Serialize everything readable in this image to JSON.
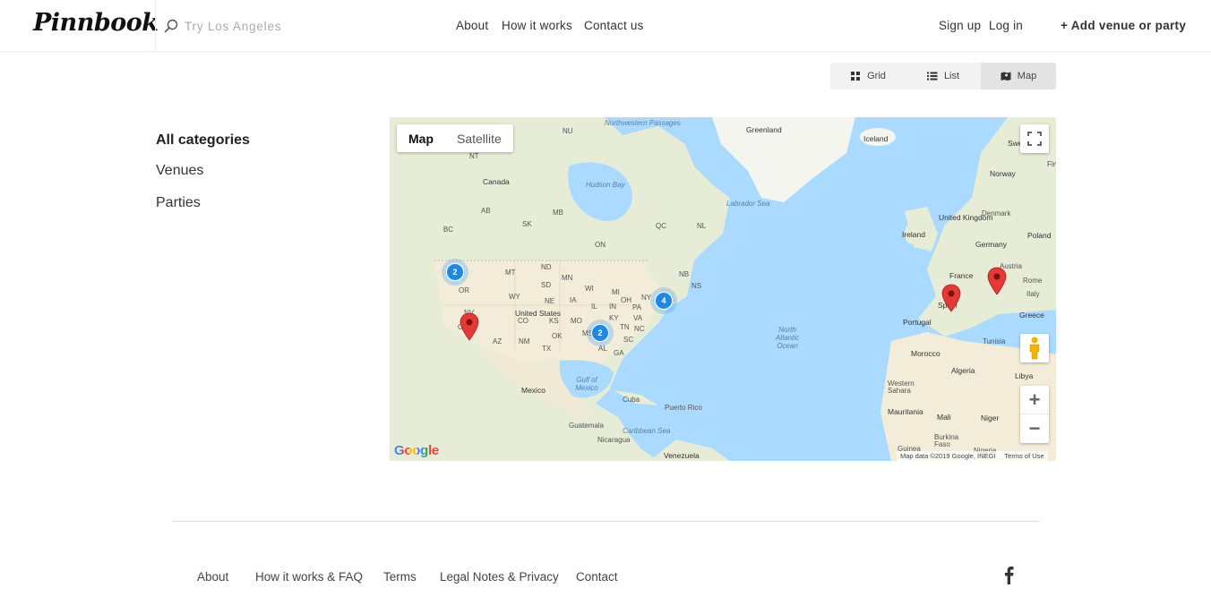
{
  "header": {
    "logo": "Pinnbook",
    "search_placeholder": "Try Los Angeles",
    "nav": [
      "About",
      "How it works",
      "Contact us"
    ],
    "signup": "Sign up",
    "login": "Log in",
    "add_venue": "+ Add venue or party"
  },
  "view_toggle": {
    "grid": "Grid",
    "list": "List",
    "map": "Map",
    "active": "map"
  },
  "categories": {
    "items": [
      "All categories",
      "Venues",
      "Parties"
    ],
    "active": "All categories"
  },
  "map": {
    "type_map": "Map",
    "type_satellite": "Satellite",
    "zoom_in": "+",
    "zoom_out": "−",
    "google": "Google",
    "attribution": "Map data ©2019 Google, INEGI",
    "terms": "Terms of Use",
    "clusters": [
      {
        "count": "2"
      },
      {
        "count": "4"
      },
      {
        "count": "2"
      }
    ],
    "labels": {
      "canada": "Canada",
      "greenland": "Greenland",
      "iceland": "Iceland",
      "norway": "Norway",
      "hudson_bay": "Hudson Bay",
      "labrador_sea": "Labrador Sea",
      "nw_passages": "Northwestern Passages",
      "ireland": "Ireland",
      "united_kingdom": "United Kingdom",
      "denmark": "Denmark",
      "germany": "Germany",
      "poland": "Poland",
      "france": "France",
      "austria": "Austria",
      "spain": "Spain",
      "portugal": "Portugal",
      "italy": "Italy",
      "rome": "Rome",
      "greece": "Greece",
      "tunisia": "Tunisia",
      "morocco": "Morocco",
      "algeria": "Algeria",
      "libya": "Libya",
      "western_sahara": "Western Sahara",
      "mauritania": "Mauritania",
      "mali": "Mali",
      "niger": "Niger",
      "burkina_faso": "Burkina Faso",
      "guinea": "Guinea",
      "nigeria": "Nigeria",
      "north_atlantic": "North Atlantic Ocean",
      "united_states": "United States",
      "mexico": "Mexico",
      "gulf_mexico": "Gulf of Mexico",
      "cuba": "Cuba",
      "puerto_rico": "Puerto Rico",
      "guatemala": "Guatemala",
      "nicaragua": "Nicaragua",
      "caribbean": "Caribbean Sea",
      "venezuela": "Venezuela",
      "sweden": "Swe",
      "finland": "Fin",
      "nu": "NU",
      "nt": "NT",
      "bc": "BC",
      "ab": "AB",
      "sk": "SK",
      "mb": "MB",
      "on": "ON",
      "qc": "QC",
      "nl": "NL",
      "nb": "NB",
      "ns": "NS",
      "mt": "MT",
      "nd": "ND",
      "or": "OR",
      "wy": "WY",
      "sd": "SD",
      "mn": "MN",
      "wi": "WI",
      "mi": "MI",
      "nv": "NV",
      "ne": "NE",
      "ia": "IA",
      "il": "IL",
      "in": "IN",
      "oh": "OH",
      "pa": "PA",
      "ny": "NY",
      "co": "CO",
      "ks": "KS",
      "mo": "MO",
      "ky": "KY",
      "va": "VA",
      "nc": "NC",
      "az": "AZ",
      "nm": "NM",
      "ok": "OK",
      "tn": "TN",
      "sc": "SC",
      "ga": "GA",
      "ms": "MS",
      "al": "AL",
      "tx": "TX",
      "ca": "CA"
    }
  },
  "footer": {
    "links": [
      "About",
      "How it works & FAQ",
      "Terms",
      "Legal Notes & Privacy",
      "Contact"
    ]
  },
  "colors": {
    "water": "#aadaff",
    "land": "#f0ecdc",
    "cluster": "#1e88e5",
    "pin": "#e53935"
  }
}
